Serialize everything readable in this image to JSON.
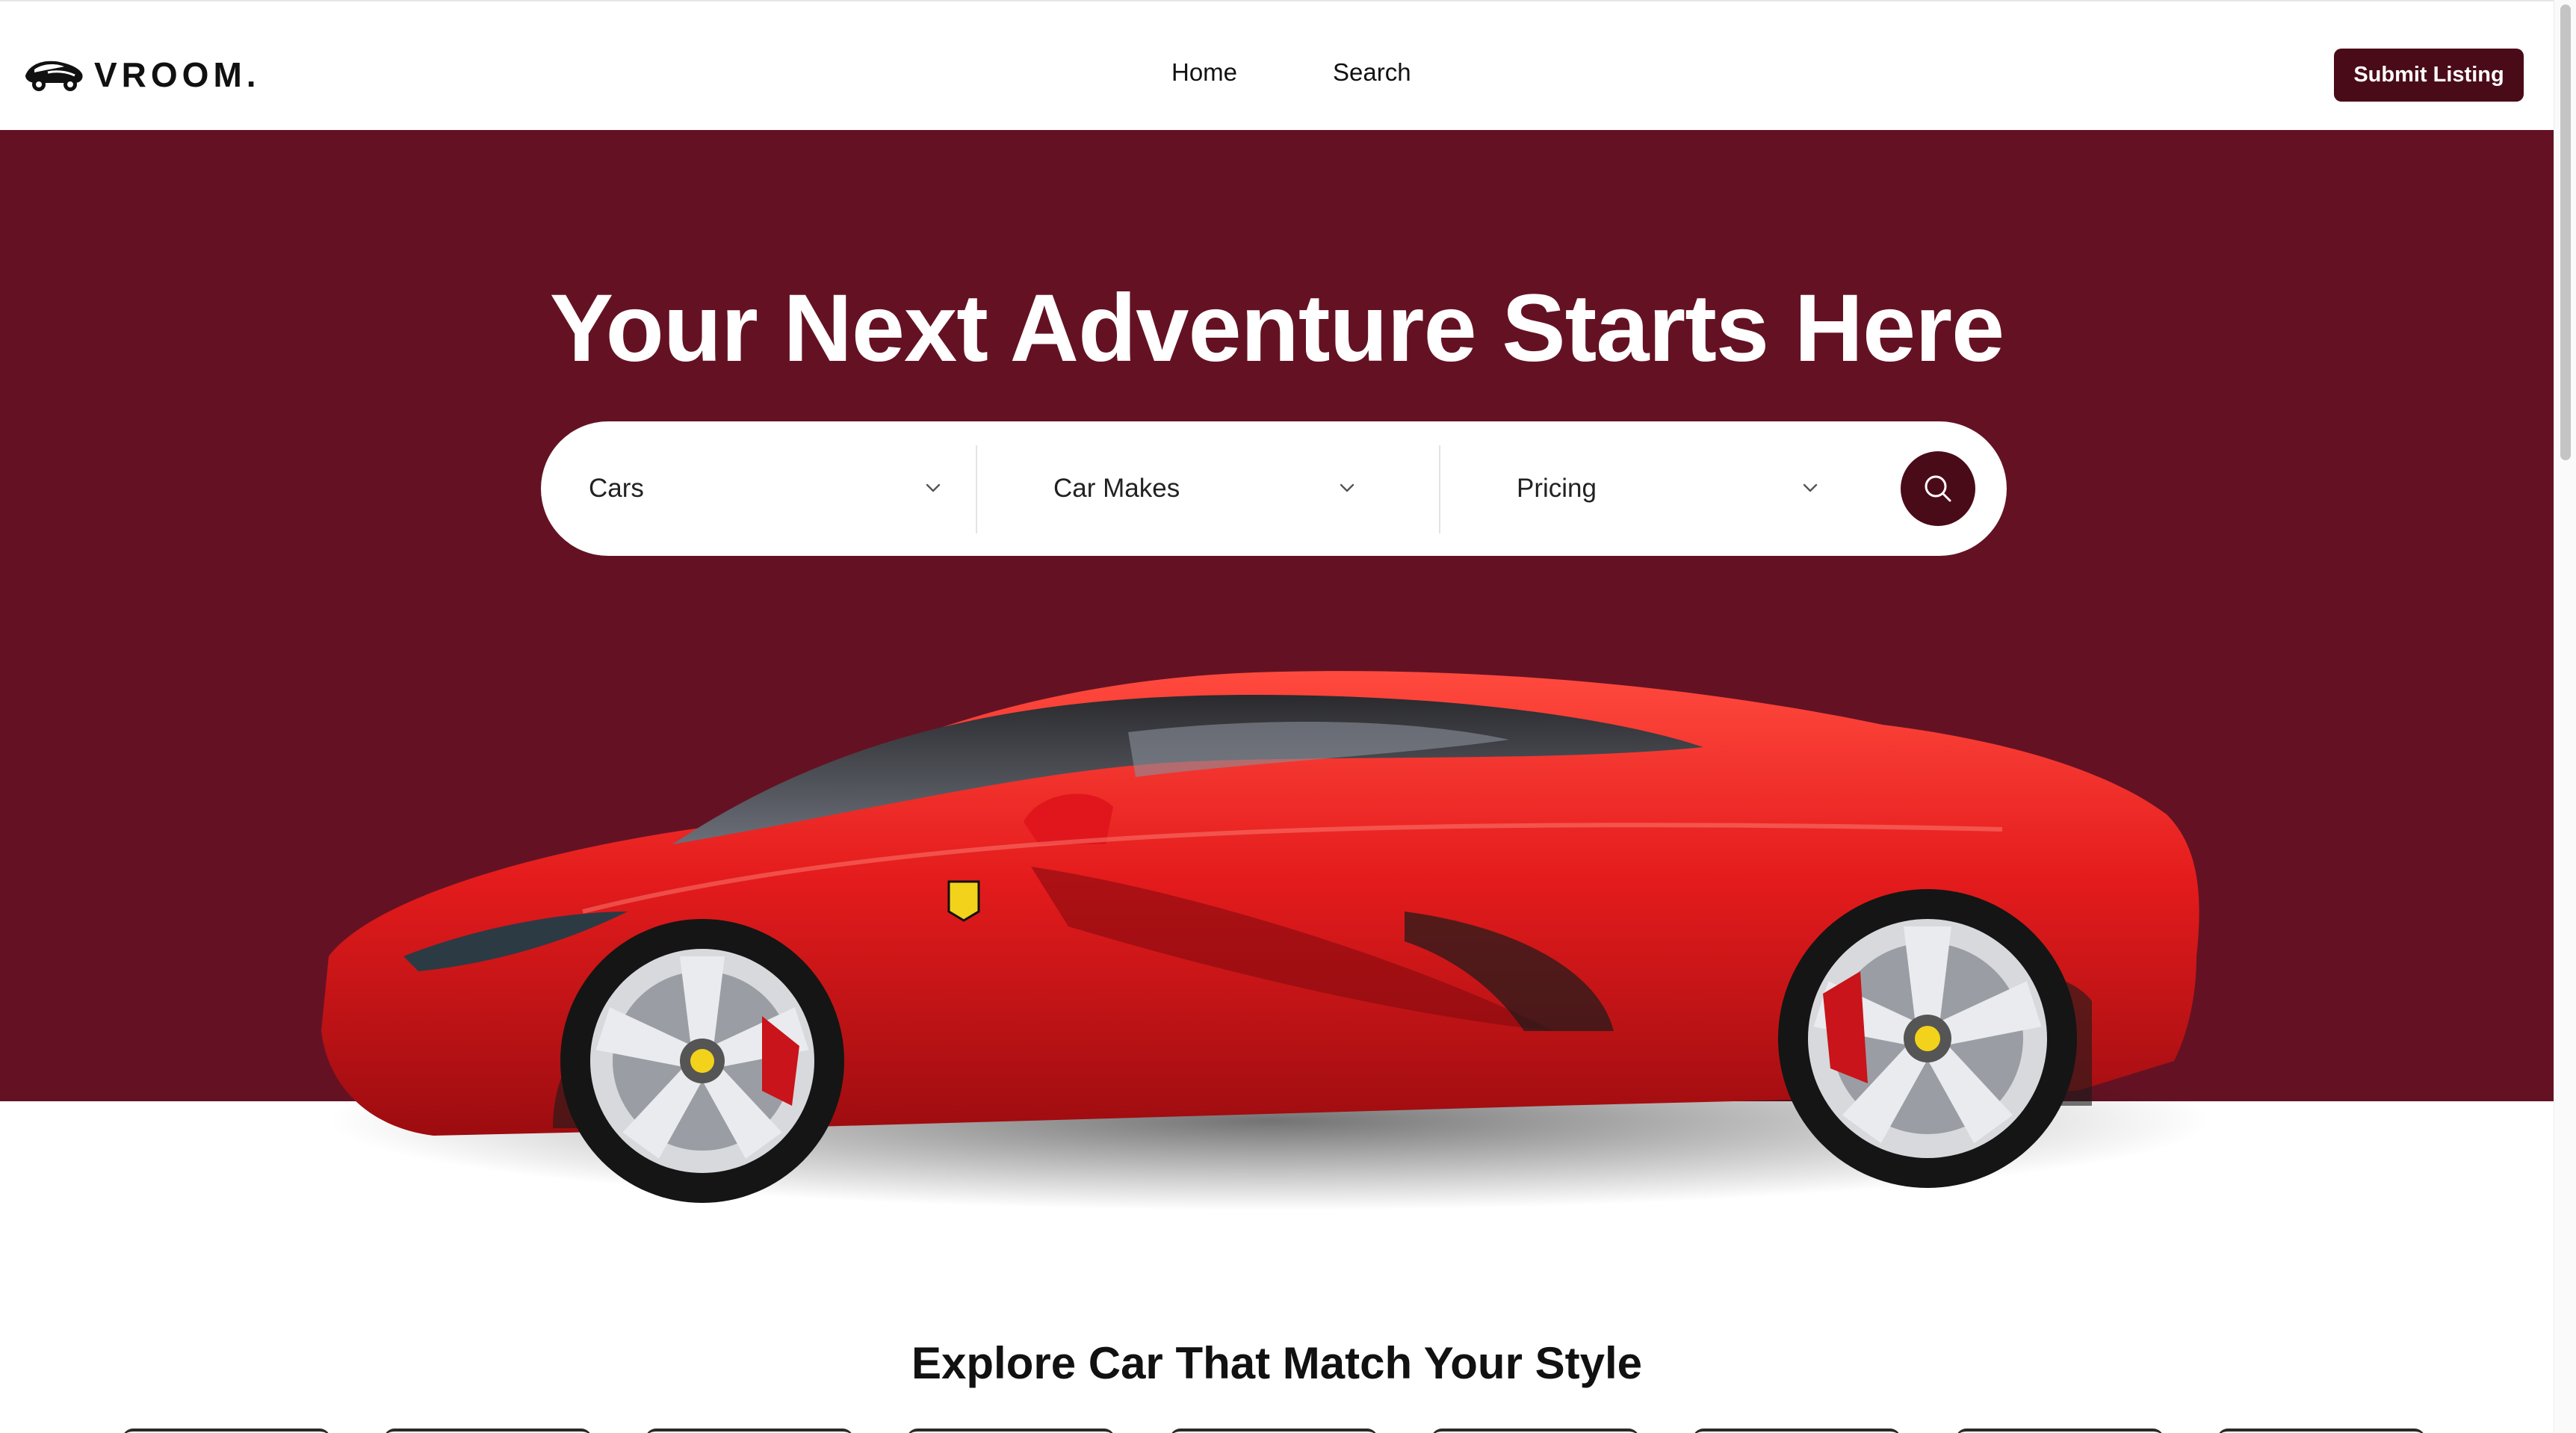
{
  "brand": {
    "name": "VROOM.",
    "logo_icon": "car-silhouette-icon"
  },
  "nav": {
    "items": [
      {
        "label": "Home"
      },
      {
        "label": "Search"
      }
    ]
  },
  "header": {
    "submit_label": "Submit Listing"
  },
  "hero": {
    "title": "Your Next Adventure Starts Here",
    "background_color": "#641223",
    "search": {
      "filters": [
        {
          "label": "Cars",
          "icon": "chevron-down-icon"
        },
        {
          "label": "Car Makes",
          "icon": "chevron-down-icon"
        },
        {
          "label": "Pricing",
          "icon": "chevron-down-icon"
        }
      ],
      "submit_icon": "search-icon"
    },
    "image": {
      "subject": "red-supercar"
    }
  },
  "explore": {
    "title": "Explore Car That Match Your Style"
  },
  "colors": {
    "accent": "#4a0b18",
    "hero": "#641223",
    "car_red": "#d8141d"
  }
}
